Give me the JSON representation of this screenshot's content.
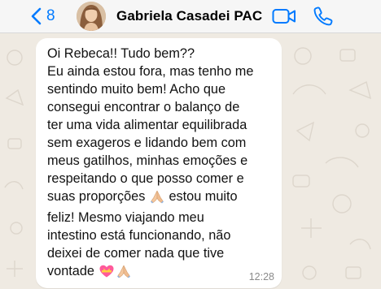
{
  "header": {
    "back_count": "8",
    "contact_name": "Gabriela Casadei PAC",
    "icons": [
      "chevron-left-icon",
      "video-call-icon",
      "phone-icon"
    ],
    "accent_color": "#007aff"
  },
  "message": {
    "lines": [
      "Oi Rebeca!! Tudo bem??",
      "Eu ainda estou fora, mas tenho me",
      "sentindo muito bem! Acho que",
      "consegui encontrar o balanço de",
      "ter uma vida alimentar equilibrada",
      "sem exageros e lidando bem com",
      "meus gatilhos, minhas emoções e",
      "respeitando o que posso comer e",
      "suas proporções",
      "estou muito",
      "feliz! Mesmo viajando meu",
      "intestino está funcionando, não",
      "deixei de comer nada que tive",
      "vontade"
    ],
    "emojis": [
      "folded-hands-emoji",
      "heart-with-ribbon-emoji",
      "folded-hands-emoji"
    ],
    "time": "12:28",
    "bubble_color": "#ffffff",
    "background_color": "#efeae2"
  }
}
